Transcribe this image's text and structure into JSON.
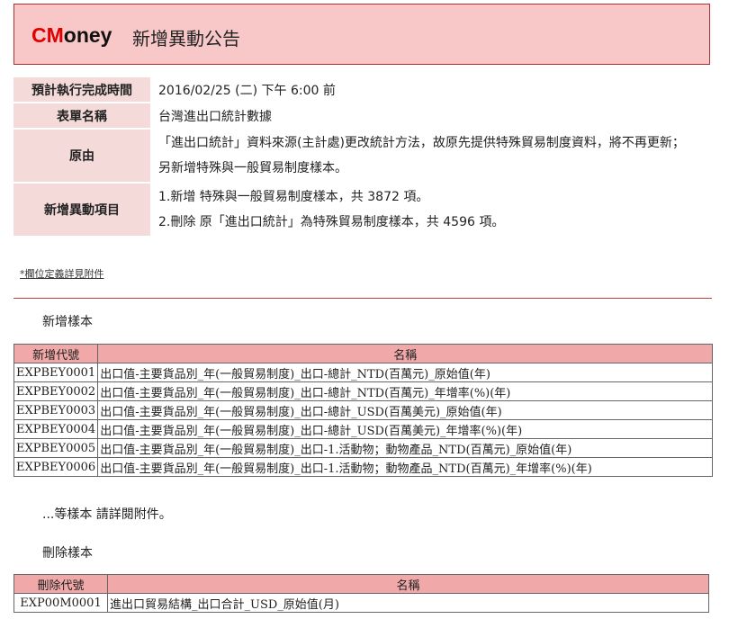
{
  "header": {
    "brand_c": "CM",
    "brand_rest": "oney",
    "title": "新增異動公告"
  },
  "info": {
    "deadline_label": "預計執行完成時間",
    "deadline_value": "2016/02/25 (二) 下午 6:00 前",
    "form_label": "表單名稱",
    "form_value": "台灣進出口統計數據",
    "reason_label": "原由",
    "reason_lines": [
      "「進出口統計」資料來源(主計處)更改統計方法，故原先提供特殊貿易制度資料，將不再更新；",
      "另新增特殊與一般貿易制度樣本。"
    ],
    "items_label": "新增異動項目",
    "items_lines": [
      "1.新增 特殊與一般貿易制度樣本，共 3872 項。",
      "2.刪除 原「進出口統計」為特殊貿易制度樣本，共 4596 項。"
    ]
  },
  "note": "*欄位定義詳見附件",
  "added": {
    "section_title": "新增樣本",
    "col_code": "新增代號",
    "col_name": "名稱",
    "rows": [
      {
        "code": "EXPBEY0001",
        "name": "出口值-主要貨品別_年(一般貿易制度)_出口-總計_NTD(百萬元)_原始值(年)"
      },
      {
        "code": "EXPBEY0002",
        "name": "出口值-主要貨品別_年(一般貿易制度)_出口-總計_NTD(百萬元)_年增率(%)(年)"
      },
      {
        "code": "EXPBEY0003",
        "name": "出口值-主要貨品別_年(一般貿易制度)_出口-總計_USD(百萬美元)_原始值(年)"
      },
      {
        "code": "EXPBEY0004",
        "name": "出口值-主要貨品別_年(一般貿易制度)_出口-總計_USD(百萬美元)_年增率(%)(年)"
      },
      {
        "code": "EXPBEY0005",
        "name": "出口值-主要貨品別_年(一般貿易制度)_出口-1.活動物；動物產品_NTD(百萬元)_原始值(年)"
      },
      {
        "code": "EXPBEY0006",
        "name": "出口值-主要貨品別_年(一般貿易制度)_出口-1.活動物；動物產品_NTD(百萬元)_年增率(%)(年)"
      }
    ],
    "more_text": "...等樣本 請詳閱附件。"
  },
  "deleted": {
    "section_title": "刪除樣本",
    "col_code": "刪除代號",
    "col_name": "名稱",
    "rows": [
      {
        "code": "EXP00M0001",
        "name": "進出口貿易結構_出口合計_USD_原始值(月)"
      }
    ]
  }
}
